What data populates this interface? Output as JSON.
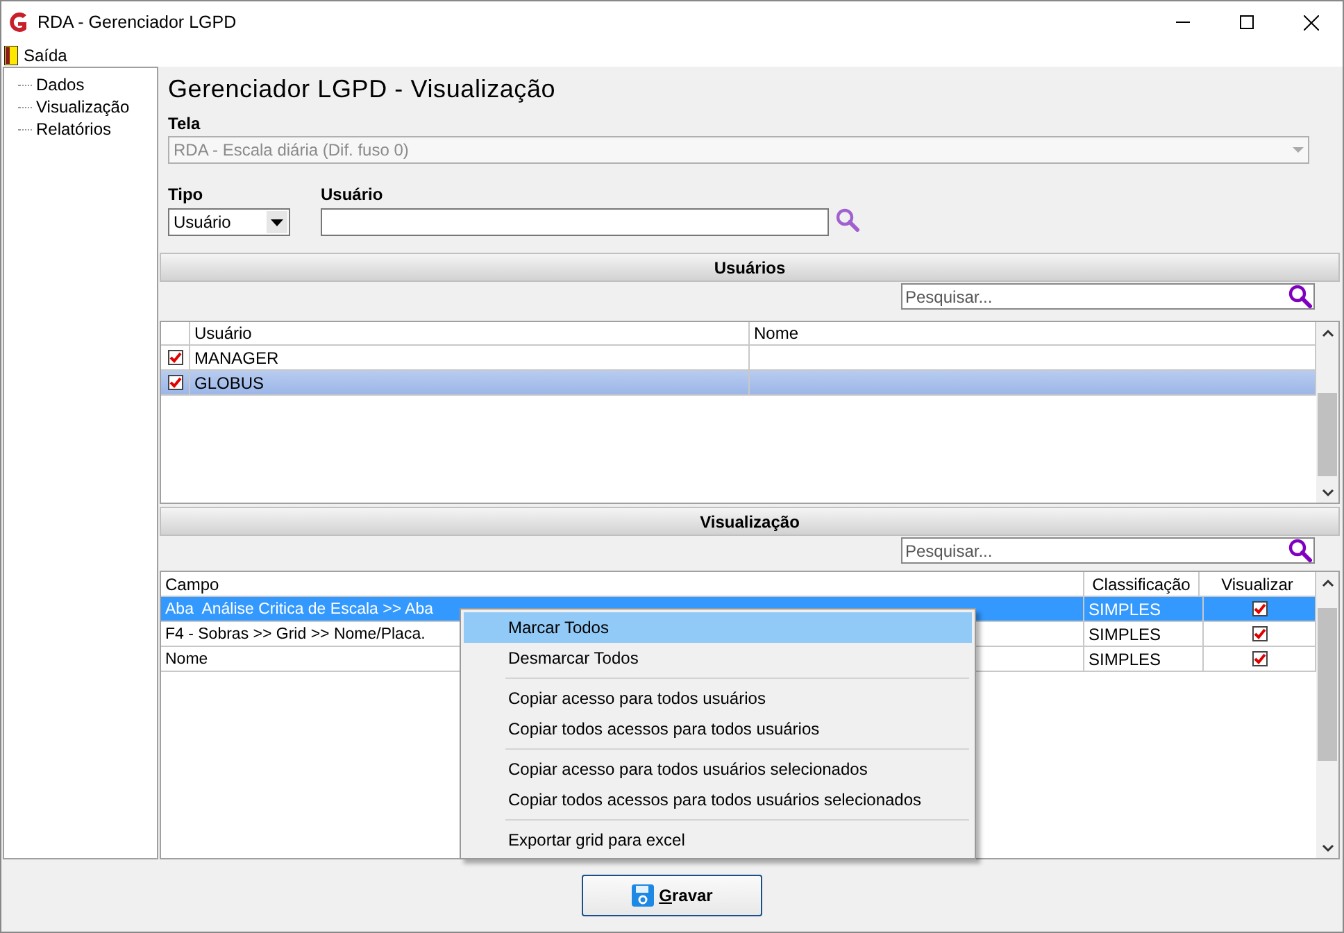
{
  "window": {
    "title": "RDA - Gerenciador LGPD"
  },
  "menu_bar": [
    {
      "label": "Saída"
    }
  ],
  "sidebar": {
    "items": [
      {
        "label": "Dados"
      },
      {
        "label": "Visualização"
      },
      {
        "label": "Relatórios"
      }
    ]
  },
  "heading": "Gerenciador LGPD - Visualização",
  "tela": {
    "label": "Tela",
    "value": "RDA - Escala diária (Dif. fuso 0)",
    "disabled": true
  },
  "tipo": {
    "label": "Tipo",
    "value": "Usuário"
  },
  "usuario": {
    "label": "Usuário"
  },
  "users": {
    "title": "Usuários",
    "search": {
      "placeholder": "Pesquisar..."
    },
    "columns": [
      "Usuário",
      "Nome"
    ],
    "rows": [
      {
        "checked": true,
        "usuario": "MANAGER",
        "selected": false
      },
      {
        "checked": true,
        "usuario": "GLOBUS",
        "selected": true
      }
    ]
  },
  "visualizacao": {
    "title": "Visualização",
    "search": {
      "placeholder": "Pesquisar..."
    },
    "columns": [
      "Campo",
      "Classificação",
      "Visualizar"
    ],
    "rows": [
      {
        "campo": "Aba  Análise Critica de Escala >> Aba",
        "classificacao": "SIMPLES",
        "visualizar": true,
        "selected": true
      },
      {
        "campo": "F4 - Sobras >> Grid >> Nome/Placa.",
        "classificacao": "SIMPLES",
        "visualizar": true,
        "selected": false
      },
      {
        "campo": "Nome",
        "classificacao": "SIMPLES",
        "visualizar": true,
        "selected": false
      }
    ]
  },
  "context_menu": {
    "groups": [
      [
        {
          "label": "Marcar Todos",
          "selected": true
        },
        {
          "label": "Desmarcar Todos",
          "selected": false
        }
      ],
      [
        {
          "label": "Copiar acesso para todos usuários",
          "selected": false
        },
        {
          "label": "Copiar todos acessos para todos usuários",
          "selected": false
        }
      ],
      [
        {
          "label": "Copiar acesso para todos usuários selecionados",
          "selected": false
        },
        {
          "label": "Copiar todos acessos para todos usuários selecionados",
          "selected": false
        }
      ],
      [
        {
          "label": "Exportar grid para excel",
          "selected": false
        }
      ]
    ]
  },
  "save_button": {
    "label": "Gravar"
  }
}
